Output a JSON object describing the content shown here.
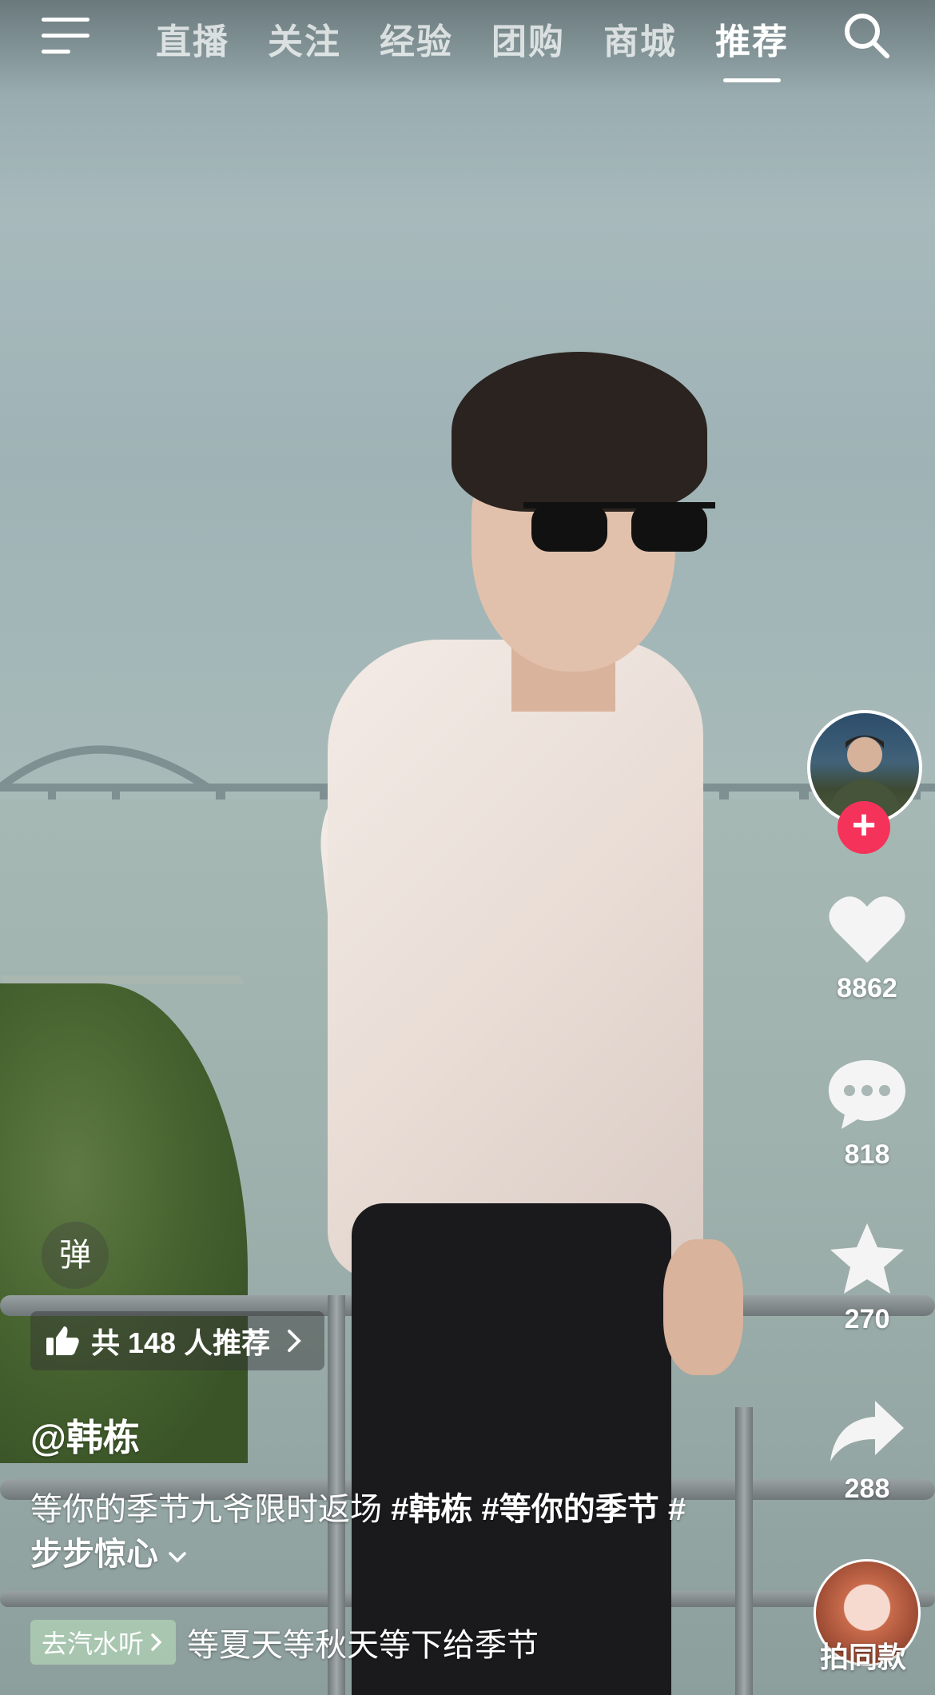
{
  "top_nav": {
    "tabs": [
      "直播",
      "关注",
      "经验",
      "团购",
      "商城",
      "推荐"
    ],
    "active_tab": "推荐"
  },
  "icons": {
    "menu": "menu-icon",
    "search": "search-icon",
    "like": "heart-icon",
    "comment": "comment-icon",
    "favorite": "star-icon",
    "share": "share-icon",
    "thumb": "thumbs-up-icon",
    "chevron": "chevron-right-icon"
  },
  "actions": {
    "like_count": "8862",
    "comment_count": "818",
    "favorite_count": "270",
    "share_count": "288"
  },
  "follow_symbol": "+",
  "danmu_label": "弹",
  "recommend_label": "共 148 人推荐",
  "author": "@韩栋",
  "caption": {
    "text": "等你的季节九爷限时返场 ",
    "tags": [
      "#韩栋",
      "#等你的季节",
      "#步步惊心"
    ]
  },
  "music": {
    "chip_label": "去汽水听",
    "title": "等夏天等秋天等下给季节"
  },
  "same_style_label": "拍同款",
  "colors": {
    "follow_red": "#f5335a",
    "chip_green": "#bee6be"
  }
}
